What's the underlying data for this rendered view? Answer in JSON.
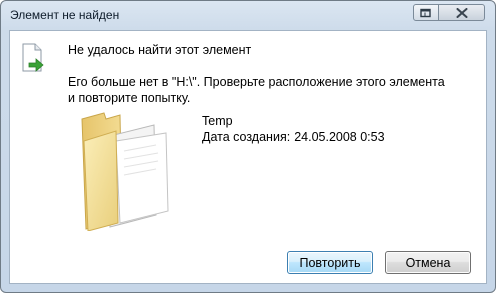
{
  "window": {
    "title": "Элемент не найден"
  },
  "dialog": {
    "heading": "Не удалось найти этот элемент",
    "message": "Его больше нет в \"H:\\\". Проверьте расположение этого элемента и повторите попытку.",
    "item": {
      "name": "Temp",
      "created_label": "Дата создания:",
      "created_value": "24.05.2008 0:53"
    }
  },
  "buttons": {
    "retry": "Повторить",
    "cancel": "Отмена"
  },
  "icons": {
    "window_restore": "window-restore-icon",
    "window_close": "close-icon",
    "document": "document-arrow-icon",
    "folder": "folder-icon"
  },
  "colors": {
    "title_bar": "#cddbea",
    "primary_button_border": "#3c7fb1",
    "arrow_green": "#3aa236",
    "folder_yellow": "#f2d98a"
  }
}
